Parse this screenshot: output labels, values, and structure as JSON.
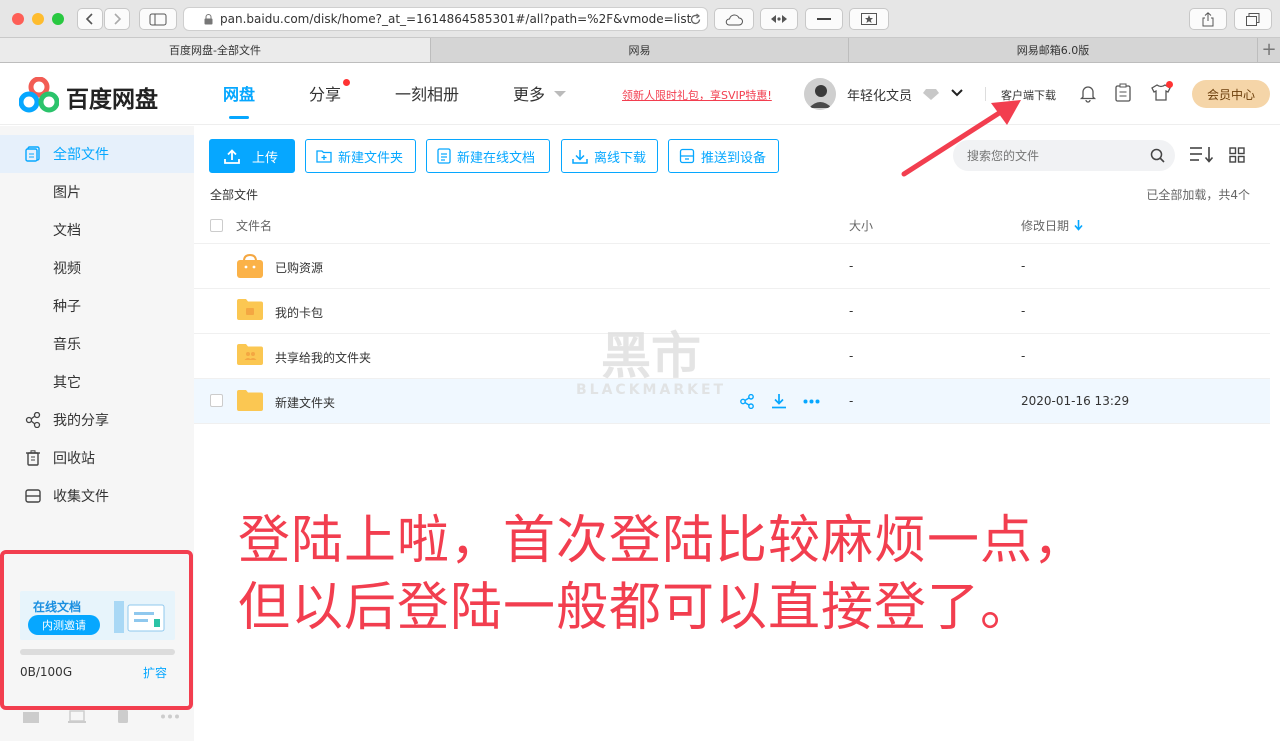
{
  "browser": {
    "url": "pan.baidu.com/disk/home?_at_=1614864585301#/all?path=%2F&vmode=list",
    "tabs": [
      "百度网盘-全部文件",
      "网易",
      "网易邮箱6.0版"
    ],
    "traffic_colors": [
      "#fe5f57",
      "#febc2e",
      "#28c840"
    ]
  },
  "app": {
    "logo_text": "百度网盘",
    "brand_color": "#06a7ff",
    "nav": [
      "网盘",
      "分享",
      "一刻相册",
      "更多"
    ],
    "promo_link": "领新人限时礼包，享SVIP特惠!",
    "username": "年轻化文员",
    "client_download": "客户端下载",
    "vip_button": "会员中心"
  },
  "sidebar": {
    "items": [
      {
        "label": "全部文件",
        "icon": "file-icon"
      },
      {
        "label": "图片"
      },
      {
        "label": "文档"
      },
      {
        "label": "视频"
      },
      {
        "label": "种子"
      },
      {
        "label": "音乐"
      },
      {
        "label": "其它"
      },
      {
        "label": "我的分享",
        "icon": "share-icon"
      },
      {
        "label": "回收站",
        "icon": "trash-icon"
      },
      {
        "label": "收集文件",
        "icon": "collect-icon"
      }
    ],
    "promo": {
      "title": "在线文档",
      "badge": "内测邀请"
    },
    "storage": {
      "used": "0B/100G",
      "used_fraction": 0.0,
      "expand": "扩容"
    }
  },
  "toolbar": {
    "upload": "上传",
    "new_folder": "新建文件夹",
    "new_doc": "新建在线文档",
    "offline_download": "离线下载",
    "push_device": "推送到设备",
    "search_placeholder": "搜索您的文件"
  },
  "breadcrumb": "全部文件",
  "load_status": "已全部加载，共4个",
  "table": {
    "headers": {
      "name": "文件名",
      "size": "大小",
      "date": "修改日期"
    },
    "rows": [
      {
        "name": "已购资源",
        "size": "-",
        "date": "-",
        "icon": "purchased-folder-icon"
      },
      {
        "name": "我的卡包",
        "size": "-",
        "date": "-",
        "icon": "card-folder-icon"
      },
      {
        "name": "共享给我的文件夹",
        "size": "-",
        "date": "-",
        "icon": "shared-folder-icon"
      },
      {
        "name": "新建文件夹",
        "size": "-",
        "date": "2020-01-16 13:29",
        "icon": "folder-icon"
      }
    ]
  },
  "watermark": {
    "cn": "黑市",
    "en": "BLACKMARKET"
  },
  "annotation": {
    "line1": "登陆上啦，首次登陆比较麻烦一点，",
    "line2": "但以后登陆一般都可以直接登了。",
    "color": "#f23e4f"
  }
}
